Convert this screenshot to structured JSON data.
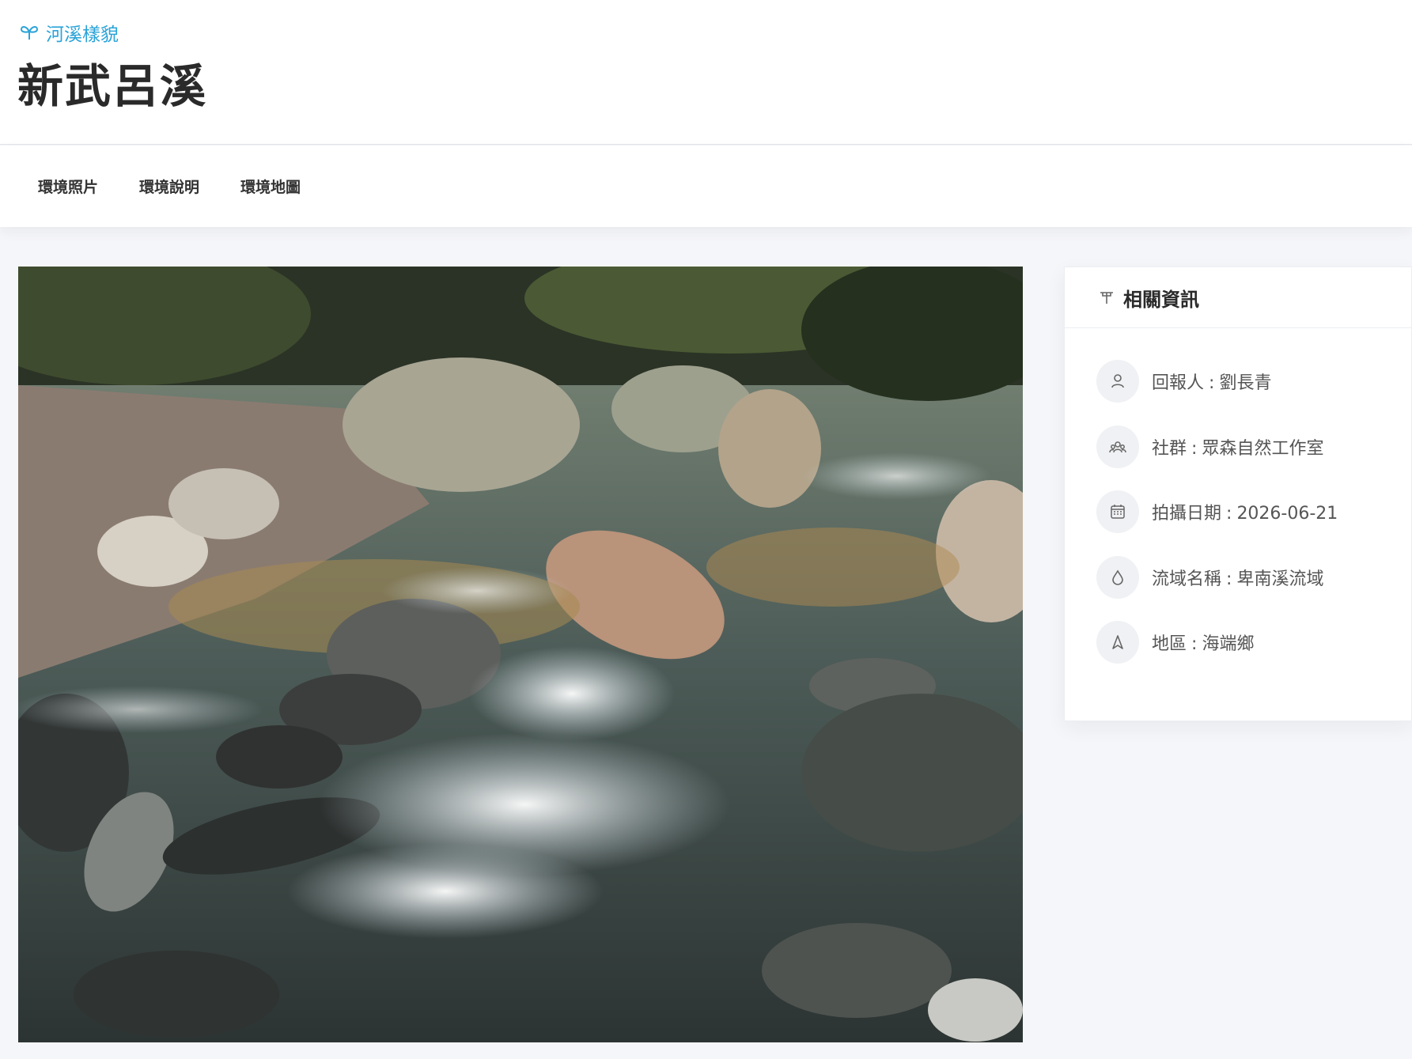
{
  "header": {
    "eyebrow": "河溪樣貌",
    "title": "新武呂溪"
  },
  "tabs": [
    {
      "label": "環境照片"
    },
    {
      "label": "環境說明"
    },
    {
      "label": "環境地圖"
    }
  ],
  "panel": {
    "title": "相關資訊",
    "items": [
      {
        "icon": "person-icon",
        "label": "回報人",
        "value": "劉長青"
      },
      {
        "icon": "group-icon",
        "label": "社群",
        "value": "眾森自然工作室"
      },
      {
        "icon": "calendar-icon",
        "label": "拍攝日期",
        "value": "2026-06-21"
      },
      {
        "icon": "droplet-icon",
        "label": "流域名稱",
        "value": "卑南溪流域"
      },
      {
        "icon": "location-icon",
        "label": "地區",
        "value": "海端鄉"
      }
    ]
  },
  "colors": {
    "accent": "#2aa3d8",
    "background": "#f5f6f9"
  }
}
